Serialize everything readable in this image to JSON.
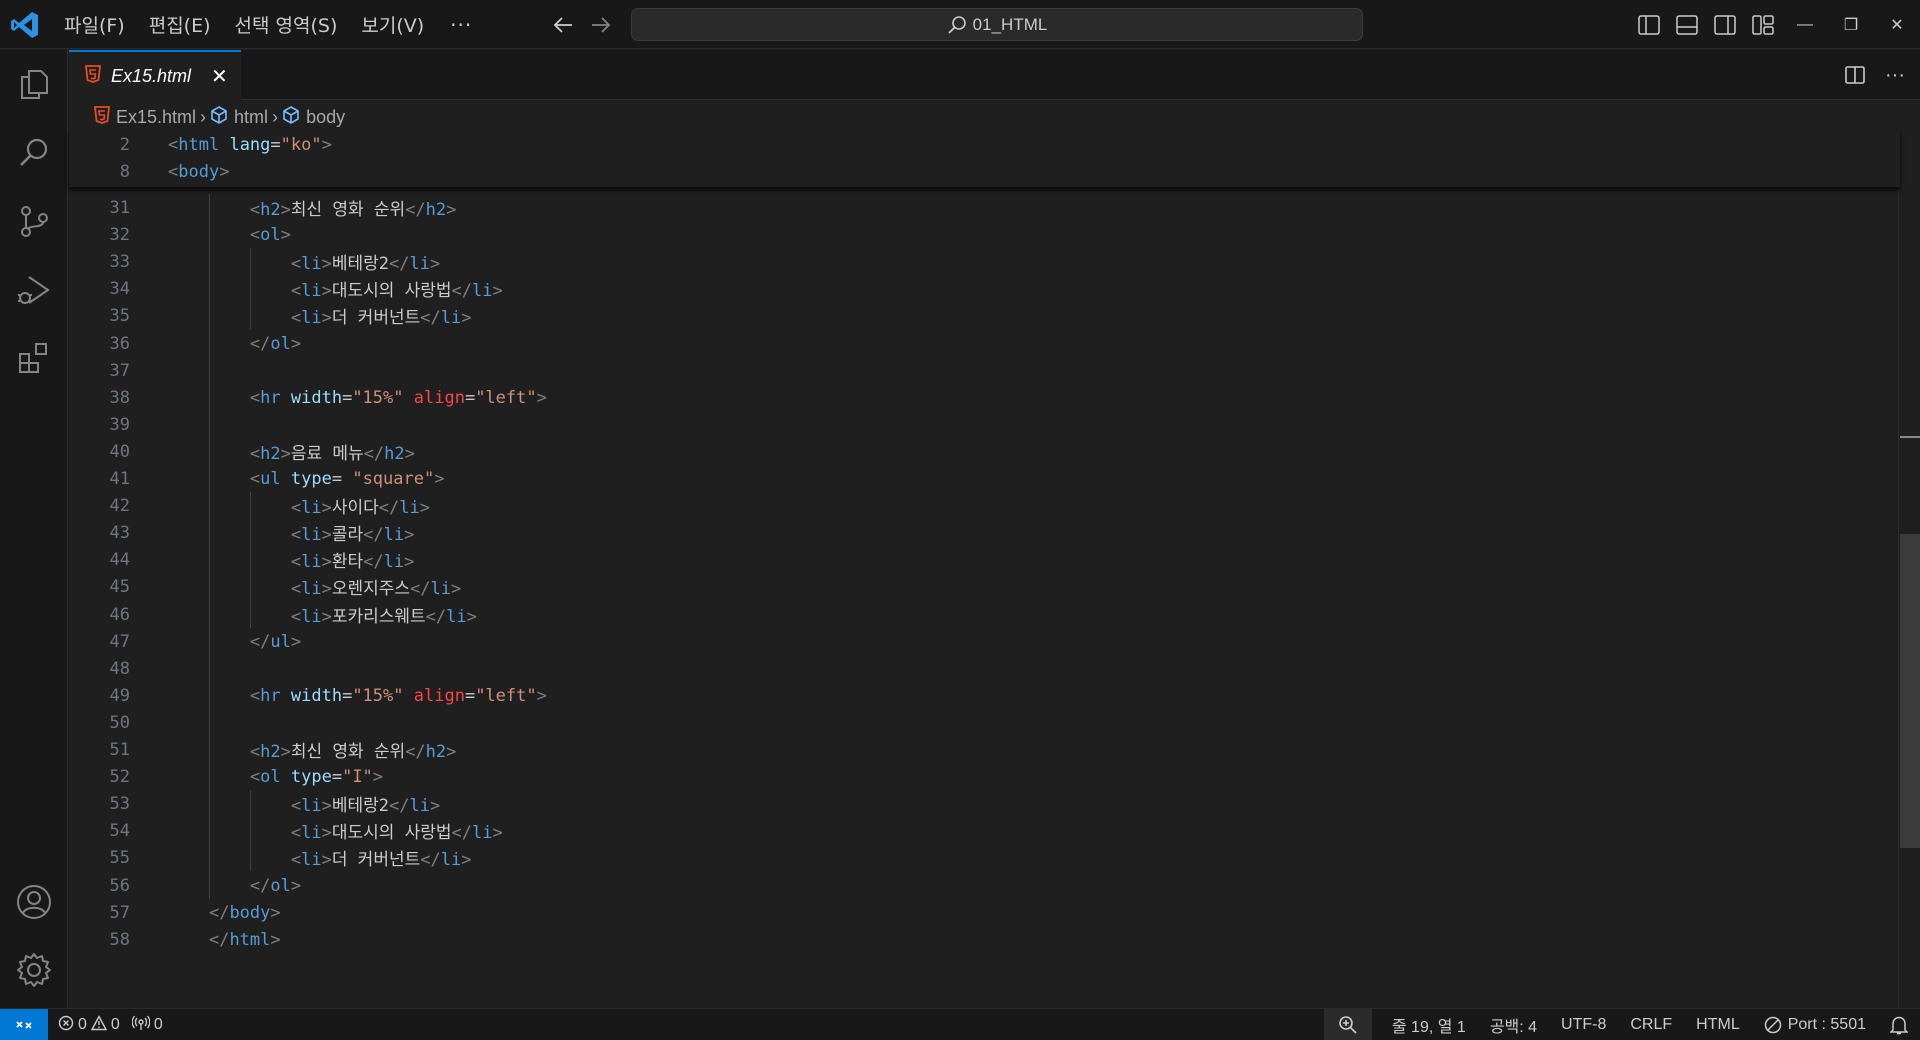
{
  "titlebar": {
    "menu": [
      "파일(F)",
      "편집(E)",
      "선택 영역(S)",
      "보기(V)"
    ],
    "more": "···",
    "search": "01_HTML",
    "minimize": "—",
    "restore": "❐",
    "close": "✕"
  },
  "activity_bar": [
    "explorer-icon",
    "search-icon",
    "source-control-icon",
    "run-debug-icon",
    "extensions-icon",
    "account-icon",
    "settings-gear-icon"
  ],
  "tab": {
    "label": "Ex15.html",
    "close": "✕"
  },
  "tab_actions": {
    "more": "···"
  },
  "breadcrumb": {
    "file": "Ex15.html",
    "items": [
      "html",
      "body"
    ]
  },
  "editor": {
    "sticky_lines": [
      {
        "n": "2",
        "code": "<html lang=\"ko\">"
      },
      {
        "n": "8",
        "code": "<body>"
      }
    ],
    "lines": [
      {
        "n": "31",
        "code": "        <h2>최신 영화 순위</h2>"
      },
      {
        "n": "32",
        "code": "        <ol>"
      },
      {
        "n": "33",
        "code": "            <li>베테랑2</li>"
      },
      {
        "n": "34",
        "code": "            <li>대도시의 사랑법</li>"
      },
      {
        "n": "35",
        "code": "            <li>더 커버넌트</li>"
      },
      {
        "n": "36",
        "code": "        </ol>"
      },
      {
        "n": "37",
        "code": ""
      },
      {
        "n": "38",
        "code": "        <hr width=\"15%\" align=\"left\">"
      },
      {
        "n": "39",
        "code": ""
      },
      {
        "n": "40",
        "code": "        <h2>음료 메뉴</h2>"
      },
      {
        "n": "41",
        "code": "        <ul type= \"square\">"
      },
      {
        "n": "42",
        "code": "            <li>사이다</li>"
      },
      {
        "n": "43",
        "code": "            <li>콜라</li>"
      },
      {
        "n": "44",
        "code": "            <li>환타</li>"
      },
      {
        "n": "45",
        "code": "            <li>오렌지주스</li>"
      },
      {
        "n": "46",
        "code": "            <li>포카리스웨트</li>"
      },
      {
        "n": "47",
        "code": "        </ul>"
      },
      {
        "n": "48",
        "code": ""
      },
      {
        "n": "49",
        "code": "        <hr width=\"15%\" align=\"left\">"
      },
      {
        "n": "50",
        "code": ""
      },
      {
        "n": "51",
        "code": "        <h2>최신 영화 순위</h2>"
      },
      {
        "n": "52",
        "code": "        <ol type=\"I\">"
      },
      {
        "n": "53",
        "code": "            <li>베테랑2</li>"
      },
      {
        "n": "54",
        "code": "            <li>대도시의 사랑법</li>"
      },
      {
        "n": "55",
        "code": "            <li>더 커버넌트</li>"
      },
      {
        "n": "56",
        "code": "        </ol>"
      },
      {
        "n": "57",
        "code": "    </body>"
      },
      {
        "n": "58",
        "code": "    </html>"
      }
    ]
  },
  "statusbar": {
    "errors": "0",
    "warnings": "0",
    "ports": "0",
    "position": "줄 19, 열 1",
    "spaces": "공백: 4",
    "encoding": "UTF-8",
    "eol": "CRLF",
    "language": "HTML",
    "live_server": "Port : 5501"
  },
  "colors": {
    "accent": "#0078d4",
    "html_icon": "#e44d26",
    "tag": "#569cd6",
    "attr": "#9cdcfe",
    "attr_red": "#f44747",
    "string": "#ce9178"
  }
}
